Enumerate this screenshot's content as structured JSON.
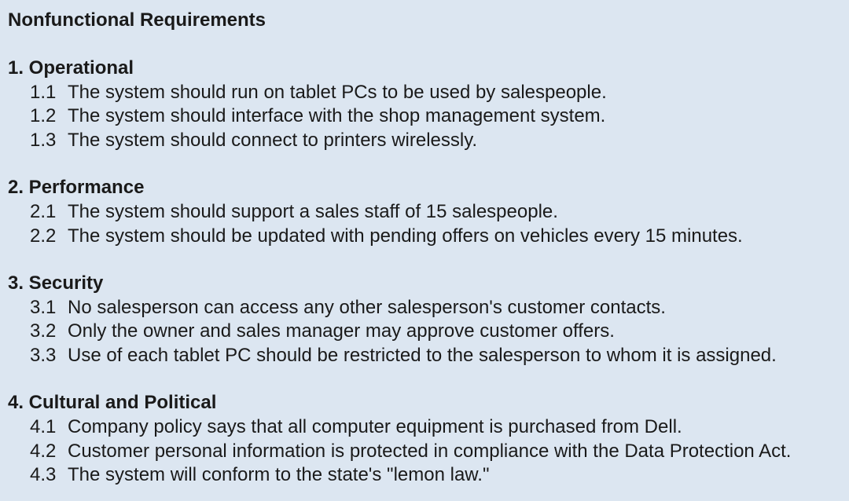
{
  "title": "Nonfunctional Requirements",
  "sections": [
    {
      "heading": "1. Operational",
      "items": [
        {
          "num": "1.1",
          "text": "The system should run on tablet PCs to be used by salespeople."
        },
        {
          "num": "1.2",
          "text": "The system should interface with the shop management system."
        },
        {
          "num": "1.3",
          "text": "The system should connect to printers wirelessly."
        }
      ]
    },
    {
      "heading": "2. Performance",
      "items": [
        {
          "num": "2.1",
          "text": "The system should support a sales staff of 15 salespeople."
        },
        {
          "num": "2.2",
          "text": "The system should be updated with pending offers on vehicles every 15 minutes."
        }
      ]
    },
    {
      "heading": "3. Security",
      "items": [
        {
          "num": "3.1",
          "text": "No salesperson can access any other salesperson's customer contacts."
        },
        {
          "num": "3.2",
          "text": "Only the owner and sales manager may approve customer offers."
        },
        {
          "num": "3.3",
          "text": "Use of each tablet PC should be restricted to the salesperson to whom it is assigned."
        }
      ]
    },
    {
      "heading": "4. Cultural and Political",
      "items": [
        {
          "num": "4.1",
          "text": "Company policy says that all computer equipment is purchased from Dell."
        },
        {
          "num": "4.2",
          "text": "Customer personal information is protected in compliance with the Data Protection Act."
        },
        {
          "num": "4.3",
          "text": "The system will conform to the state's \"lemon law.\""
        }
      ]
    }
  ],
  "colors": {
    "background": "#dce6f1",
    "text": "#1a1a1a"
  }
}
